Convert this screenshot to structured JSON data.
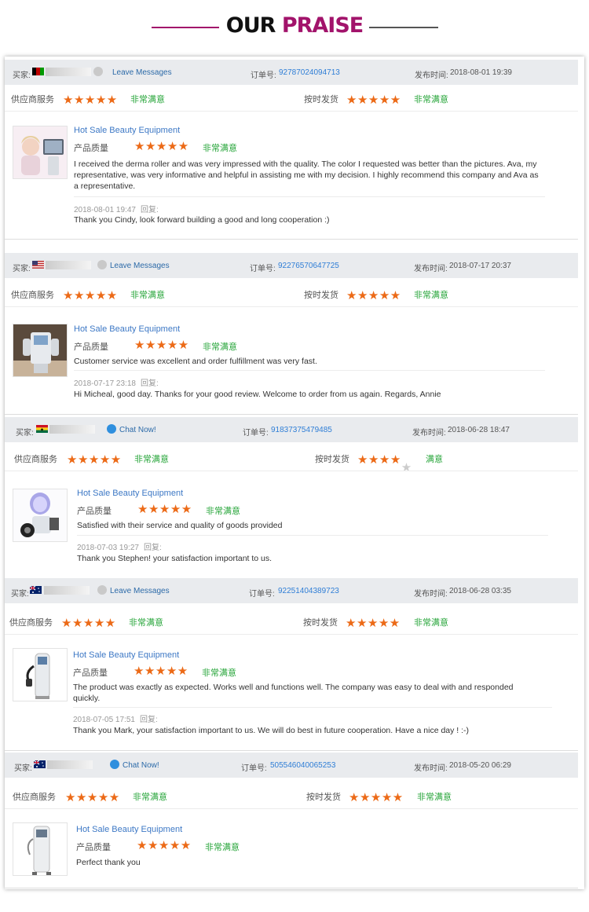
{
  "title": {
    "word1": "OUR",
    "word2": "PRAISE"
  },
  "labels": {
    "buyer": "买家:",
    "order": "订单号:",
    "published": "发布时间:",
    "supplier_service": "供应商服务",
    "on_time": "按时发货",
    "product_quality": "产品质量",
    "reply": "回复:"
  },
  "colors": {
    "accent": "#a2136b",
    "star": "#ec6a17",
    "green": "#27a53a",
    "link": "#3d78c5",
    "header_bg": "#e9ebee"
  },
  "reviews": [
    {
      "contact": "Leave Messages",
      "contact_icon": "avatar-icon",
      "flag": "afghanistan-flag-icon",
      "order_no": "92787024094713",
      "date": "2018-08-01 19:39",
      "supplier_stars": 5,
      "supplier_text": "非常满意",
      "ontime_stars": 5,
      "ontime_text": "非常满意",
      "product_name": "Hot Sale Beauty Equipment",
      "pq_stars": 5,
      "pq_text": "非常满意",
      "comment": "I received the derma roller and was very impressed with the quality. The color I requested was better than the pictures. Ava, my representative, was very informative and helpful in assisting me with my decision. I highly recommend this company and Ava as a representative.",
      "reply_date": "2018-08-01 19:47",
      "reply": "Thank you Cindy, look forward building a good and long cooperation :)"
    },
    {
      "contact": "Leave Messages",
      "contact_icon": "avatar-icon",
      "flag": "usa-flag-icon",
      "order_no": "92276570647725",
      "date": "2018-07-17 20:37",
      "supplier_stars": 5,
      "supplier_text": "非常满意",
      "ontime_stars": 5,
      "ontime_text": "非常满意",
      "product_name": "Hot Sale Beauty Equipment",
      "pq_stars": 5,
      "pq_text": "非常满意",
      "comment": "Customer service was excellent and order fulfillment was very fast.",
      "reply_date": "2018-07-17 23:18",
      "reply": "Hi Micheal, good day. Thanks for your good review. Welcome to order from us again. Regards, Annie"
    },
    {
      "contact": "Chat Now!",
      "contact_icon": "chat-icon",
      "flag": "ghana-flag-icon",
      "order_no": "91837375479485",
      "date": "2018-06-28 18:47",
      "supplier_stars": 5,
      "supplier_text": "非常满意",
      "ontime_stars": 4,
      "ontime_text": "满意",
      "product_name": "Hot Sale Beauty Equipment",
      "pq_stars": 5,
      "pq_text": "非常满意",
      "comment": "Satisfied with their service and quality of goods provided",
      "reply_date": "2018-07-03 19:27",
      "reply": "Thank you Stephen! your satisfaction important to us."
    },
    {
      "contact": "Leave Messages",
      "contact_icon": "avatar-icon",
      "flag": "australia-flag-icon",
      "order_no": "92251404389723",
      "date": "2018-06-28 03:35",
      "supplier_stars": 5,
      "supplier_text": "非常满意",
      "ontime_stars": 5,
      "ontime_text": "非常满意",
      "product_name": "Hot Sale Beauty Equipment",
      "pq_stars": 5,
      "pq_text": "非常满意",
      "comment": "The product was exactly as expected. Works well and functions well. The company was easy to deal with and responded quickly.",
      "reply_date": "2018-07-05 17:51",
      "reply": "Thank you Mark, your satisfaction important to us. We will do best in future cooperation. Have a nice day ! :-)"
    },
    {
      "contact": "Chat Now!",
      "contact_icon": "chat-icon",
      "flag": "australia-flag-icon",
      "order_no": "505546040065253",
      "date": "2018-05-20 06:29",
      "supplier_stars": 5,
      "supplier_text": "非常满意",
      "ontime_stars": 5,
      "ontime_text": "非常满意",
      "product_name": "Hot Sale Beauty Equipment",
      "pq_stars": 5,
      "pq_text": "非常满意",
      "comment": "Perfect thank you",
      "reply_date": "",
      "reply": ""
    }
  ]
}
